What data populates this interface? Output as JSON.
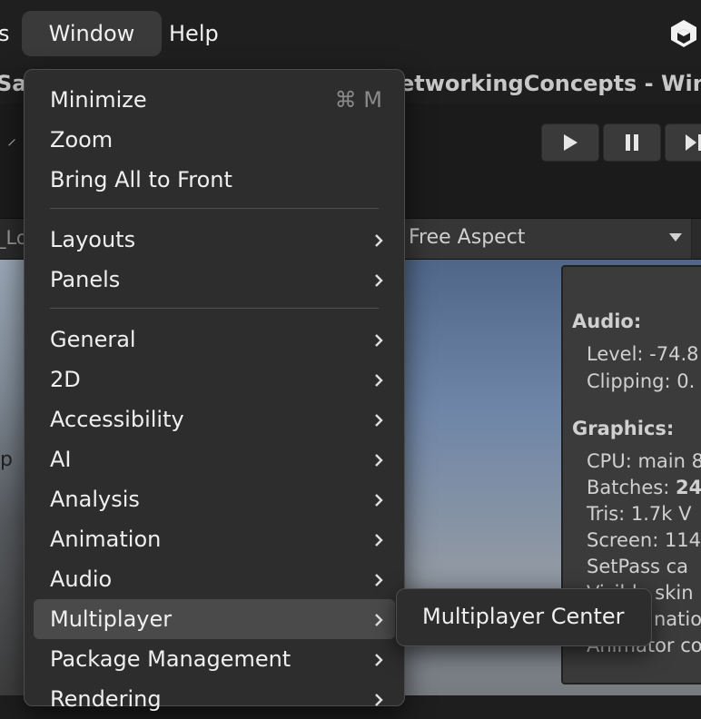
{
  "menubar": {
    "partial_left": "s",
    "items": [
      "Window",
      "Help"
    ]
  },
  "titlebar": {
    "left_fragment": "Sar",
    "right_fragment": "etworkingConcepts - Win"
  },
  "scene": {
    "tab_fragment": "_Lo",
    "left_label": "p",
    "aspect_dropdown": "Free Aspect"
  },
  "stats": {
    "audio_header": "Audio:",
    "level": "Level: -74.8",
    "clipping": "Clipping: 0.",
    "graphics_header": "Graphics:",
    "cpu": "CPU: main 8",
    "batches_label": "Batches: ",
    "batches_value": "24",
    "tris": "Tris: 1.7k   V",
    "screen": "Screen: 114",
    "setpass": "SetPass ca",
    "visible_skin": "Visible skin",
    "animation": "nation c",
    "animator": "Animator co"
  },
  "window_menu": {
    "items": [
      {
        "label": "Minimize",
        "shortcut": "⌘ M"
      },
      {
        "label": "Zoom"
      },
      {
        "label": "Bring All to Front"
      },
      {
        "label": "Layouts"
      },
      {
        "label": "Panels"
      },
      {
        "label": "General"
      },
      {
        "label": "2D"
      },
      {
        "label": "Accessibility"
      },
      {
        "label": "AI"
      },
      {
        "label": "Analysis"
      },
      {
        "label": "Animation"
      },
      {
        "label": "Audio"
      },
      {
        "label": "Multiplayer"
      },
      {
        "label": "Package Management"
      },
      {
        "label": "Rendering"
      }
    ],
    "highlighted": "Multiplayer"
  },
  "multiplayer_submenu": {
    "items": [
      {
        "label": "Multiplayer Center"
      }
    ]
  },
  "icons": {
    "app_logo": "unity-logo-icon",
    "submenu_arrow": "chevron-right-icon",
    "play": "play-icon",
    "pause": "pause-icon",
    "step": "step-icon"
  }
}
